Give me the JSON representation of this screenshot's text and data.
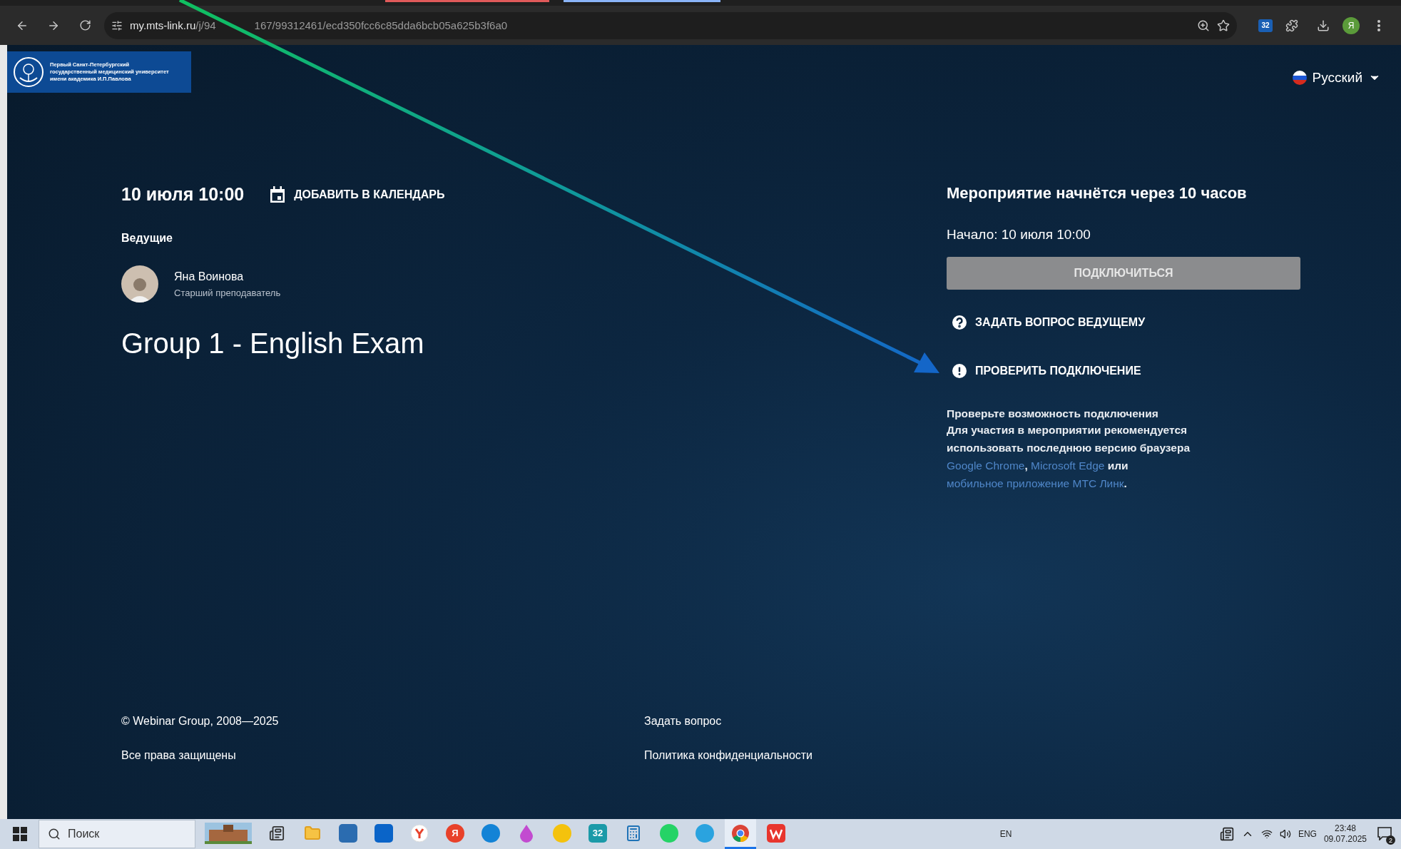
{
  "browser": {
    "url_host": "my.mts-link.ru",
    "url_path": [
      "/j/94",
      "167/99312461/ecd350fcc6c85dda6bcb05a625b3f6a0"
    ],
    "extension_label": "32",
    "profile_initial": "Я"
  },
  "header": {
    "logo_lines": [
      "Первый Санкт-Петербургский",
      "государственный медицинский университет",
      "имени академика И.П.Павлова"
    ],
    "language": "Русский"
  },
  "event": {
    "date": "10 июля 10:00",
    "add_to_calendar": "ДОБАВИТЬ В КАЛЕНДАРЬ",
    "hosts_label": "Ведущие",
    "hosts": [
      {
        "name": "Яна Воинова",
        "role": "Старший преподаватель"
      }
    ],
    "title": "Group 1 - English Exam"
  },
  "join": {
    "countdown": "Мероприятие начнётся через 10 часов",
    "start": "Начало: 10 июля 10:00",
    "connect_button": {
      "label": "ПОДКЛЮЧИТЬСЯ",
      "disabled": true
    },
    "actions": [
      {
        "kind": "question",
        "label": "ЗАДАТЬ ВОПРОС ВЕДУЩЕМУ"
      },
      {
        "kind": "warning",
        "label": "ПРОВЕРИТЬ ПОДКЛЮЧЕНИЕ"
      }
    ],
    "notice": {
      "title": "Проверьте возможность подключения",
      "parts": [
        {
          "kind": "text",
          "text": "Для участия в мероприятии рекомендуется использовать последнюю версию браузера "
        },
        {
          "kind": "link",
          "text": "Google Chrome"
        },
        {
          "kind": "text",
          "text": ", "
        },
        {
          "kind": "link",
          "text": "Microsoft Edge"
        },
        {
          "kind": "text",
          "text": " или "
        },
        {
          "kind": "link",
          "text": "мобильное приложение МТС Линк"
        },
        {
          "kind": "text",
          "text": "."
        }
      ]
    }
  },
  "footer": {
    "copyright": "© Webinar Group, 2008—2025",
    "rights": "Все права защищены",
    "links": [
      "Задать вопрос",
      "Политика конфиденциальности"
    ]
  },
  "taskbar": {
    "search_placeholder": "Поиск",
    "apps": [
      {
        "kind": "photo",
        "selected": false
      },
      {
        "kind": "taskview",
        "selected": false
      },
      {
        "kind": "folder",
        "selected": false
      },
      {
        "kind": "store",
        "selected": false
      },
      {
        "kind": "mail",
        "selected": false
      },
      {
        "kind": "ybrowser",
        "selected": false
      },
      {
        "kind": "letter",
        "label": "Я",
        "selected": false
      },
      {
        "kind": "edge",
        "selected": false
      },
      {
        "kind": "drop",
        "selected": false
      },
      {
        "kind": "yellow",
        "selected": false
      },
      {
        "kind": "badge",
        "label": "32",
        "selected": false
      },
      {
        "kind": "calc",
        "selected": false
      },
      {
        "kind": "whatsapp",
        "selected": false
      },
      {
        "kind": "telegram",
        "selected": false
      },
      {
        "kind": "chrome",
        "selected": true
      },
      {
        "kind": "wps",
        "selected": false
      }
    ],
    "input_indicator": "EN",
    "language": "ENG",
    "time": "23:48",
    "date": "09.07.2025",
    "notifications": "2"
  }
}
